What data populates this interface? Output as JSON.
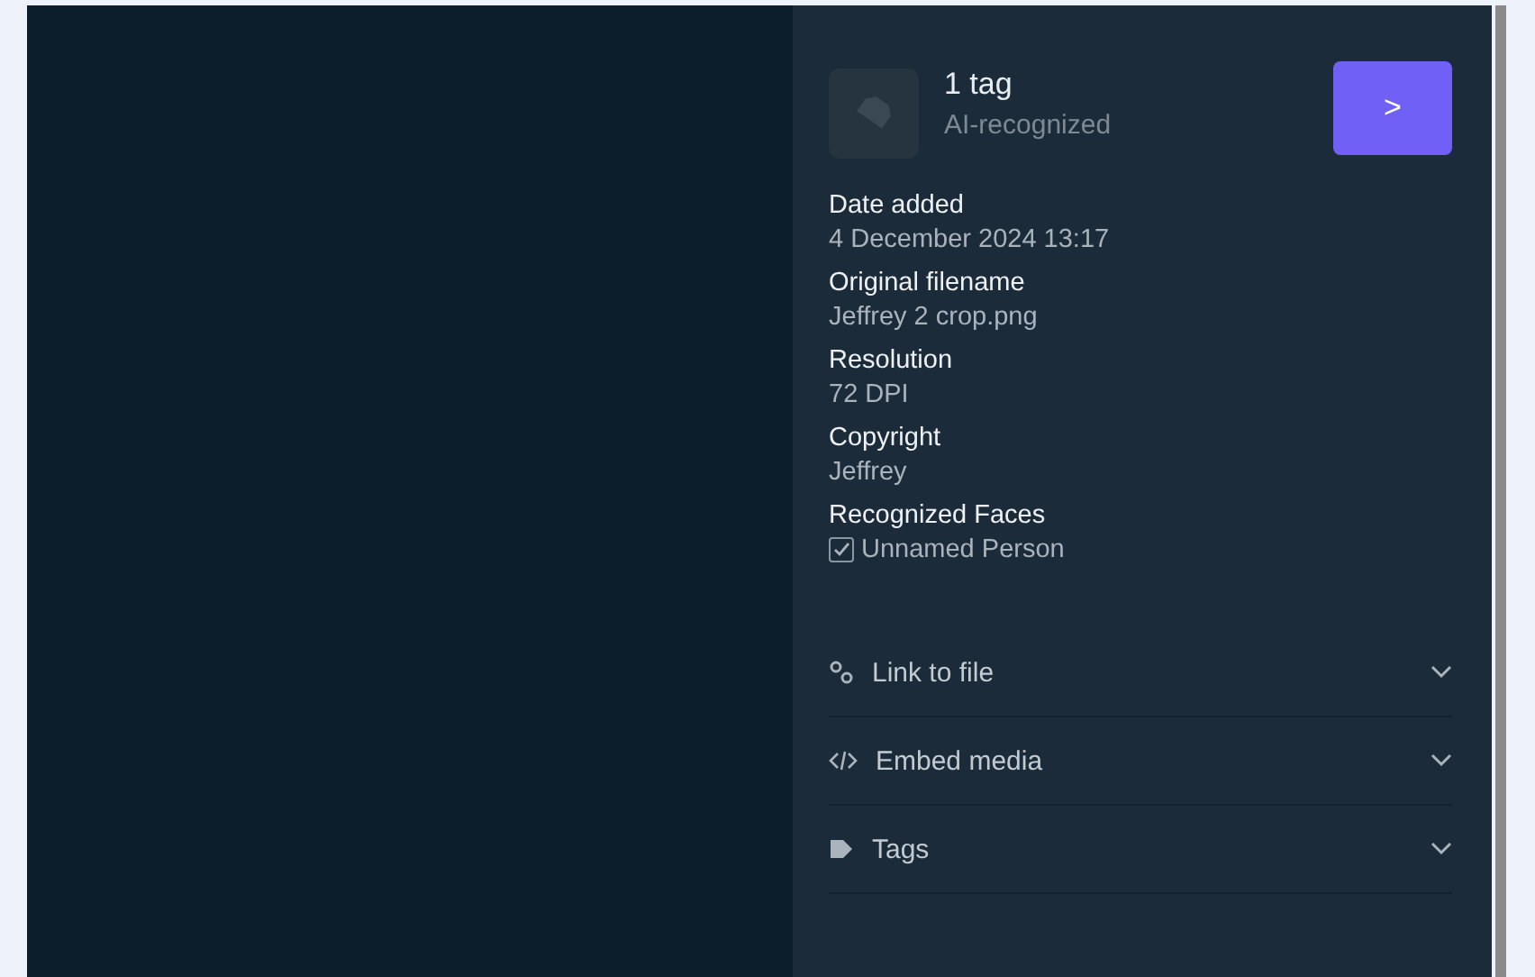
{
  "tag_summary": {
    "count": "1 tag",
    "source": "AI-recognized",
    "button": ">"
  },
  "details": [
    {
      "label": "Date added",
      "value": "4 December 2024 13:17"
    },
    {
      "label": "Original filename",
      "value": "Jeffrey 2 crop.png"
    },
    {
      "label": "Resolution",
      "value": "72 DPI"
    },
    {
      "label": "Copyright",
      "value": "Jeffrey"
    }
  ],
  "faces": {
    "label": "Recognized Faces",
    "items": [
      {
        "name": "Unnamed Person",
        "checked": true
      }
    ]
  },
  "sections": [
    {
      "kind": "link",
      "label": "Link to file",
      "expanded": false
    },
    {
      "kind": "embed",
      "label": "Embed media",
      "expanded": false
    },
    {
      "kind": "tags",
      "label": "Tags",
      "expanded": false
    }
  ]
}
